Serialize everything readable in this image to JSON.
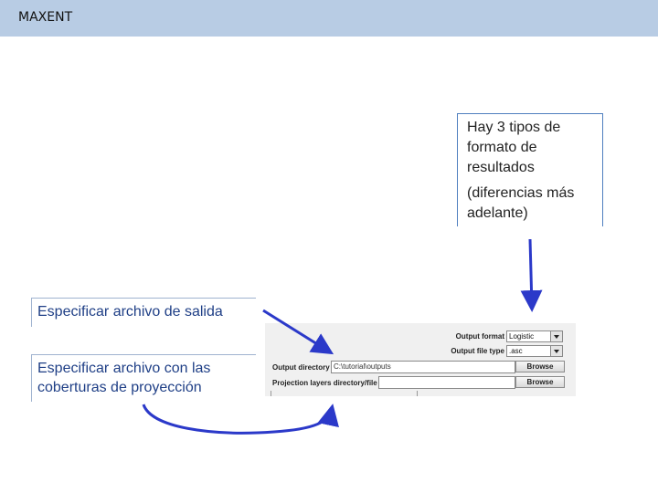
{
  "header": {
    "title": "MAXENT"
  },
  "callout": {
    "line1": "Hay 3 tipos de formato de resultados",
    "line2": "(diferencias más adelante)"
  },
  "labels": {
    "output": "Especificar archivo de salida",
    "projection": "Especificar archivo con las coberturas de proyección"
  },
  "panel": {
    "output_format_label": "Output format",
    "output_format_value": "Logistic",
    "output_file_type_label": "Output file type",
    "output_file_type_value": ".asc",
    "output_directory_label": "Output directory",
    "output_directory_value": "C:\\tutorial\\outputs",
    "projection_label": "Projection layers directory/file",
    "projection_value": "",
    "browse_label": "Browse"
  },
  "colors": {
    "arrow": "#2b39c9",
    "header": "#b8cce4"
  }
}
